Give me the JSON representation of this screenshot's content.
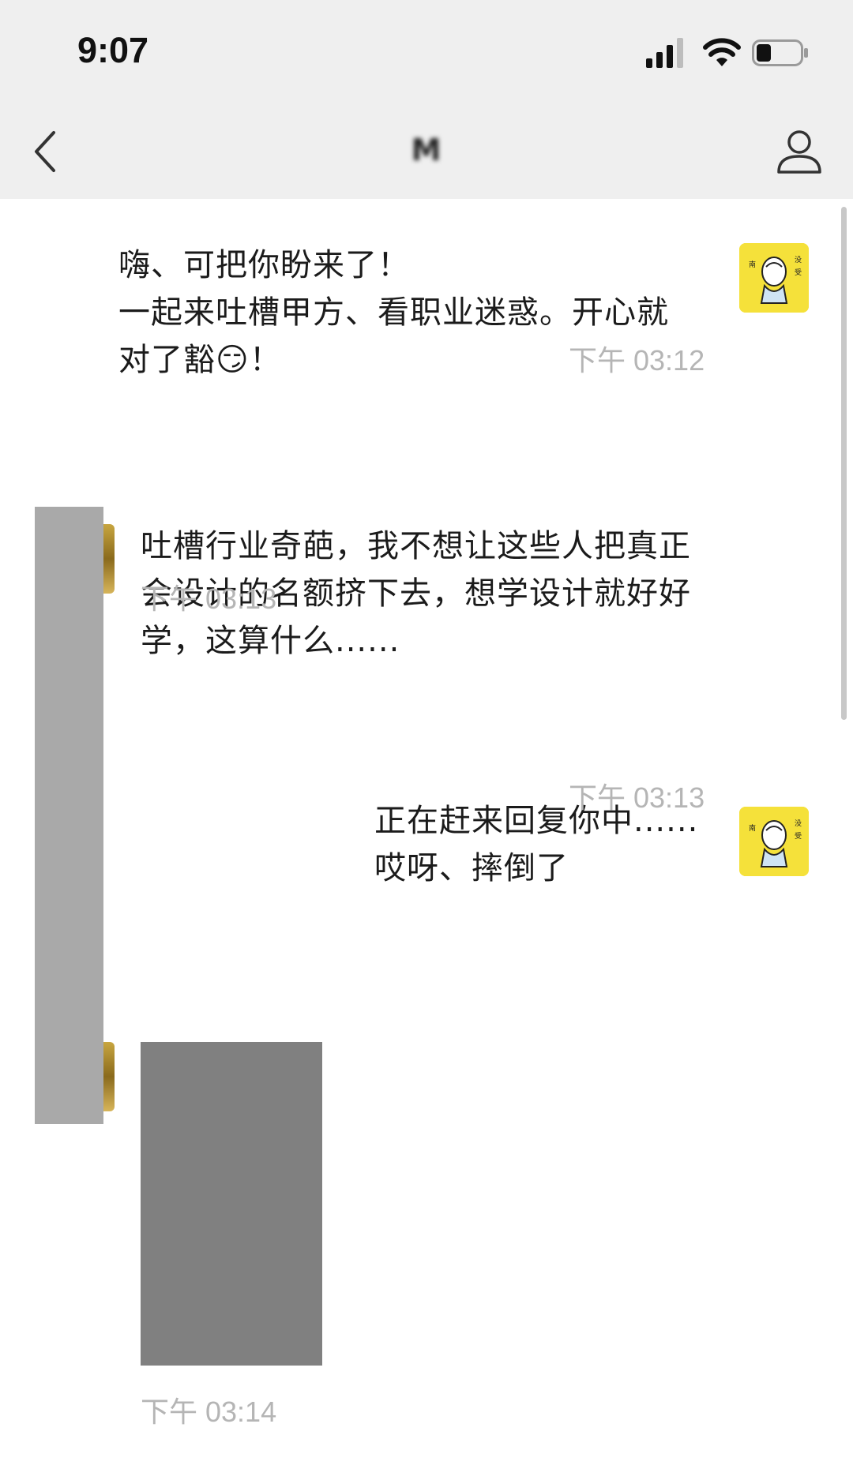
{
  "status_bar": {
    "time": "9:07"
  },
  "nav": {
    "title": "M"
  },
  "messages": [
    {
      "side": "right",
      "lines": [
        "嗨、可把你盼来了！",
        "一起来吐槽甲方、看职业迷惑。开心就",
        "对了豁😏！"
      ],
      "time": "下午 03:12"
    },
    {
      "side": "left",
      "lines": [
        "吐槽行业奇葩，我不想让这些人把真正",
        "会设计的名额挤下去，想学设计就好好",
        "学，这算什么......"
      ],
      "time": "下午 03:13"
    },
    {
      "side": "right",
      "lines": [
        "正在赶来回复你中......",
        "哎呀、摔倒了"
      ],
      "time": "下午 03:13"
    },
    {
      "side": "left",
      "type": "image",
      "time": "下午 03:14"
    }
  ],
  "colors": {
    "bar_bg": "#efefef",
    "avatar_yellow": "#f5e13a",
    "timestamp": "#b5b5b5",
    "redacted": "#a9a9a9",
    "image_placeholder": "#808080"
  },
  "icons": [
    "back-icon",
    "profile-icon",
    "signal-icon",
    "wifi-icon",
    "battery-icon"
  ]
}
